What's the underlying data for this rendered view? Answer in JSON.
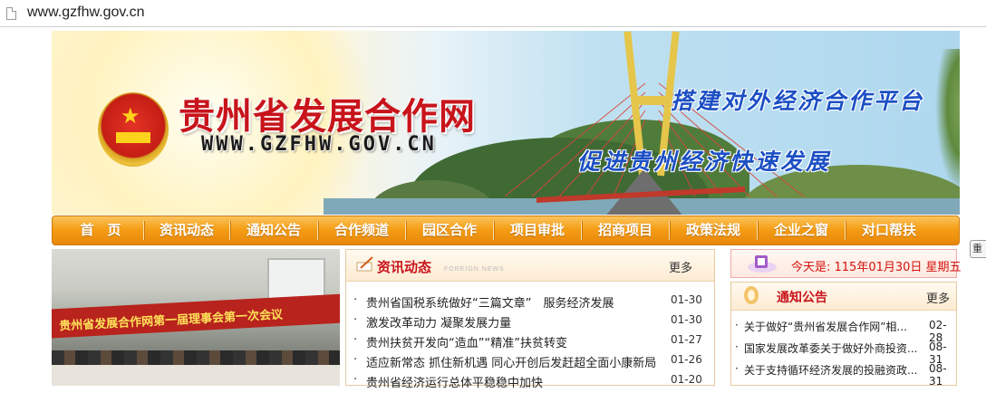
{
  "browser": {
    "url": "www.gzfhw.gov.cn"
  },
  "header": {
    "site_title": "贵州省发展合作网",
    "site_url": "WWW.GZFHW.GOV.CN",
    "slogan_1": "搭建对外经济合作平台",
    "slogan_2": "促进贵州经济快速发展"
  },
  "nav": {
    "items": [
      {
        "label": "首　页"
      },
      {
        "label": "资讯动态"
      },
      {
        "label": "通知公告"
      },
      {
        "label": "合作频道"
      },
      {
        "label": "园区合作"
      },
      {
        "label": "项目审批"
      },
      {
        "label": "招商项目"
      },
      {
        "label": "政策法规"
      },
      {
        "label": "企业之窗"
      },
      {
        "label": "对口帮扶"
      }
    ]
  },
  "photo": {
    "caption": "贵州省发展合作网第一届理事会第一次会议"
  },
  "news": {
    "title": "资讯动态",
    "subtitle": "FOREIGN NEWS",
    "more_label": "更多",
    "items": [
      {
        "title": "贵州省国税系统做好“三篇文章”　服务经济发展",
        "date": "01-30"
      },
      {
        "title": "激发改革动力 凝聚发展力量",
        "date": "01-30"
      },
      {
        "title": "贵州扶贫开发向“造血”“精准”扶贫转变",
        "date": "01-27"
      },
      {
        "title": "适应新常态 抓住新机遇 同心开创后发赶超全面小康新局",
        "date": "01-26"
      },
      {
        "title": "贵州省经济运行总体平稳稳中加快",
        "date": "01-20"
      }
    ]
  },
  "today": {
    "text": "今天是: 115年01月30日 星期五"
  },
  "notice": {
    "title": "通知公告",
    "more_label": "更多",
    "items": [
      {
        "title": "关于做好“贵州省发展合作网”相...",
        "date": "02-28"
      },
      {
        "title": "国家发展改革委关于做好外商投资...",
        "date": "08-31"
      },
      {
        "title": "关于支持循环经济发展的投融资政...",
        "date": "08-31"
      }
    ]
  },
  "side_tab": {
    "label": "重"
  },
  "colors": {
    "nav_orange": "#f59e16",
    "title_red": "#c8141b",
    "slogan_blue": "#1c4fc4"
  }
}
